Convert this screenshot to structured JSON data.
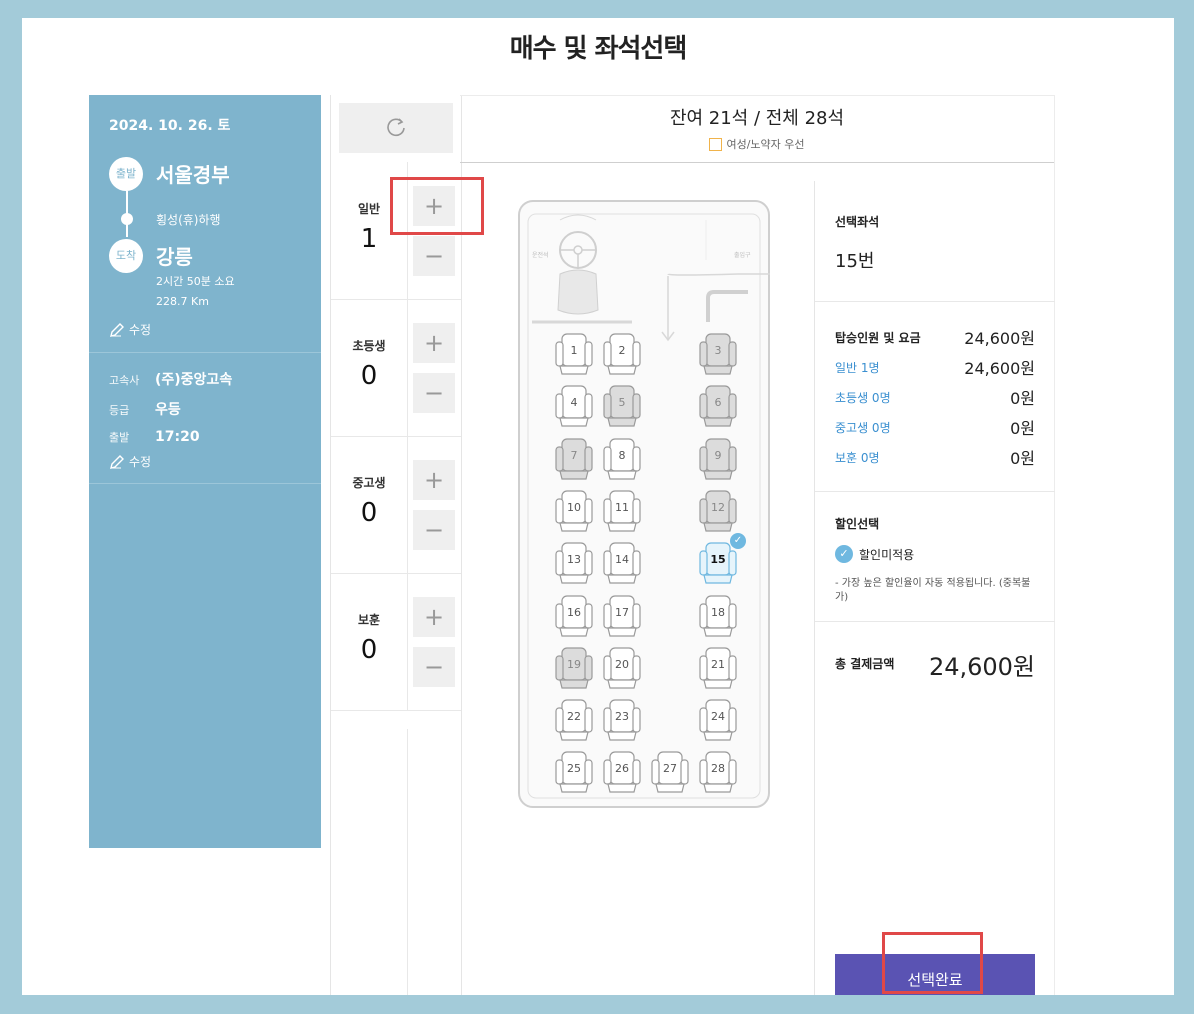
{
  "page": {
    "title": "매수 및 좌석선택"
  },
  "trip": {
    "date": "2024. 10. 26. 토",
    "depart_badge": "출발",
    "depart_city": "서울경부",
    "via": "횡성(휴)하행",
    "arrive_badge": "도착",
    "arrive_city": "강릉",
    "duration": "2시간 50분 소요",
    "distance": "228.7 Km",
    "edit_label": "수정",
    "company_label": "고속사",
    "company": "(주)중앙고속",
    "grade_label": "등급",
    "grade": "우등",
    "time_label": "출발",
    "time": "17:20",
    "edit_label2": "수정"
  },
  "passengers": [
    {
      "name": "일반",
      "count": "1"
    },
    {
      "name": "초등생",
      "count": "0"
    },
    {
      "name": "중고생",
      "count": "0"
    },
    {
      "name": "보훈",
      "count": "0"
    }
  ],
  "seat_map": {
    "remaining": "잔여 21석 / 전체 28석",
    "legend": "여성/노약자 우선",
    "driver_label": "운전석",
    "entrance_label": "출입구",
    "seats": [
      {
        "no": "1",
        "status": "available"
      },
      {
        "no": "2",
        "status": "available"
      },
      {
        "no": "3",
        "status": "sold"
      },
      {
        "no": "4",
        "status": "available"
      },
      {
        "no": "5",
        "status": "sold"
      },
      {
        "no": "6",
        "status": "sold"
      },
      {
        "no": "7",
        "status": "sold"
      },
      {
        "no": "8",
        "status": "available"
      },
      {
        "no": "9",
        "status": "sold"
      },
      {
        "no": "10",
        "status": "available"
      },
      {
        "no": "11",
        "status": "available"
      },
      {
        "no": "12",
        "status": "sold"
      },
      {
        "no": "13",
        "status": "available"
      },
      {
        "no": "14",
        "status": "available"
      },
      {
        "no": "15",
        "status": "selected"
      },
      {
        "no": "16",
        "status": "available"
      },
      {
        "no": "17",
        "status": "available"
      },
      {
        "no": "18",
        "status": "available"
      },
      {
        "no": "19",
        "status": "sold"
      },
      {
        "no": "20",
        "status": "available"
      },
      {
        "no": "21",
        "status": "available"
      },
      {
        "no": "22",
        "status": "available"
      },
      {
        "no": "23",
        "status": "available"
      },
      {
        "no": "24",
        "status": "available"
      },
      {
        "no": "25",
        "status": "available"
      },
      {
        "no": "26",
        "status": "available"
      },
      {
        "no": "27",
        "status": "available"
      },
      {
        "no": "28",
        "status": "available"
      }
    ]
  },
  "summary": {
    "selected_title": "선택좌석",
    "selected_seat": "15번",
    "fare_title": "탑승인원 및 요금",
    "fare_total": "24,600원",
    "fares": [
      {
        "label": "일반 1명",
        "amount": "24,600원"
      },
      {
        "label": "초등생 0명",
        "amount": "0원"
      },
      {
        "label": "중고생 0명",
        "amount": "0원"
      },
      {
        "label": "보훈 0명",
        "amount": "0원"
      }
    ],
    "discount_title": "할인선택",
    "discount_option": "할인미적용",
    "discount_note": "- 가장 높은 할인율이 자동 적용됩니다. (중복불가)",
    "total_label": "총 결제금액",
    "total_amount": "24,600원",
    "confirm_label": "선택완료"
  },
  "colors": {
    "accent": "#5a53b3",
    "info_bg": "#7fb4cd",
    "selected": "#6fb8e0",
    "highlight": "#e04848"
  }
}
